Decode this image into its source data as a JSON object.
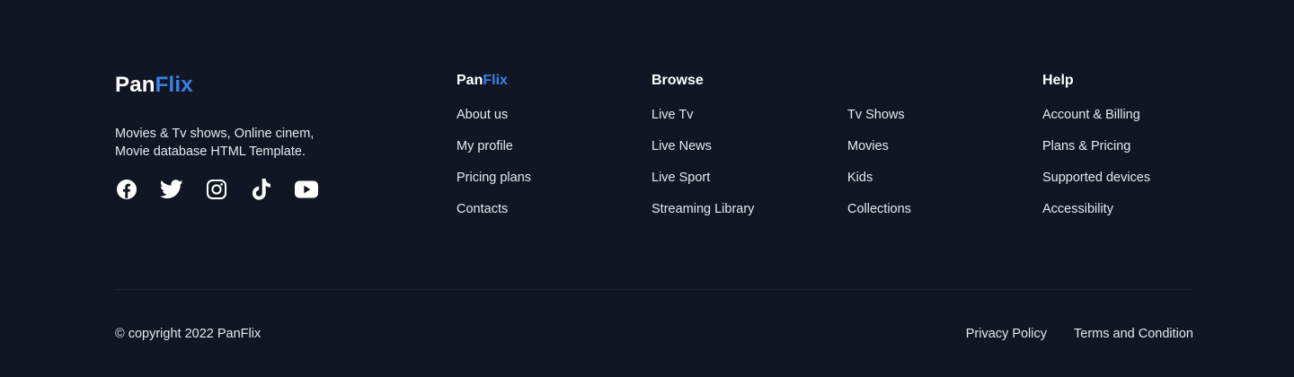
{
  "brand": {
    "name_part1": "Pan",
    "name_part2": "Flix",
    "description": "Movies & Tv shows, Online cinem, Movie database HTML Template.",
    "accent_color": "#3a82ea"
  },
  "socials": [
    {
      "icon": "facebook-icon"
    },
    {
      "icon": "twitter-icon"
    },
    {
      "icon": "instagram-icon"
    },
    {
      "icon": "tiktok-icon"
    },
    {
      "icon": "youtube-icon"
    }
  ],
  "columns": {
    "panflix": {
      "title_part1": "Pan",
      "title_part2": "Flix",
      "links": [
        "About us",
        "My profile",
        "Pricing plans",
        "Contacts"
      ]
    },
    "browse": {
      "title": "Browse",
      "links": [
        "Live Tv",
        "Live News",
        "Live Sport",
        "Streaming Library"
      ]
    },
    "browse_more": {
      "links": [
        "Tv Shows",
        "Movies",
        "Kids",
        "Collections"
      ]
    },
    "help": {
      "title": "Help",
      "links": [
        "Account & Billing",
        "Plans & Pricing",
        "Supported devices",
        "Accessibility"
      ]
    }
  },
  "bottom": {
    "copyright": "© copyright 2022 PanFlix",
    "privacy": "Privacy Policy",
    "terms": "Terms and Condition"
  },
  "colors": {
    "background": "#111622",
    "divider": "#1c2231",
    "text": "#e6e8ee"
  }
}
